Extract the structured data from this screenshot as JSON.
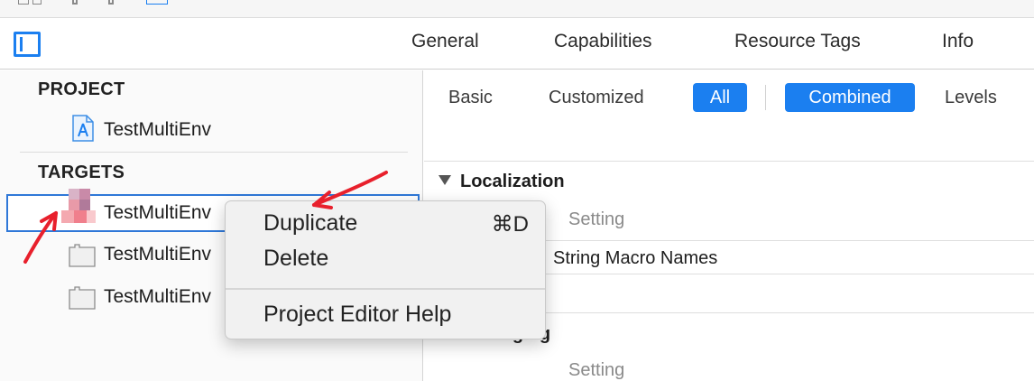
{
  "tabs": {
    "general": "General",
    "capabilities": "Capabilities",
    "resource_tags": "Resource Tags",
    "info": "Info"
  },
  "sidebar": {
    "project_header": "PROJECT",
    "project_item": "TestMultiEnv",
    "targets_header": "TARGETS",
    "targets": [
      {
        "label": "TestMultiEnv",
        "selected": true
      },
      {
        "label": "TestMultiEnv"
      },
      {
        "label": "TestMultiEnv"
      }
    ]
  },
  "filters": {
    "basic": "Basic",
    "customized": "Customized",
    "all": "All",
    "combined": "Combined",
    "levels": "Levels"
  },
  "settings": {
    "localization_title": "Localization",
    "column_setting": "Setting",
    "localization_row": "String Macro Names",
    "packaging_title": "Packaging",
    "column_setting_2": "Setting"
  },
  "context_menu": {
    "duplicate": "Duplicate",
    "duplicate_shortcut": "⌘D",
    "delete": "Delete",
    "help": "Project Editor Help"
  },
  "colors": {
    "accent": "#1b7ff0",
    "selection_border": "#2f78d8",
    "annotation_arrow": "#e8202c"
  },
  "icons": {
    "toggle": "sidebar-toggle-icon",
    "project": "xcodeproj-icon",
    "target": "target-icon"
  }
}
